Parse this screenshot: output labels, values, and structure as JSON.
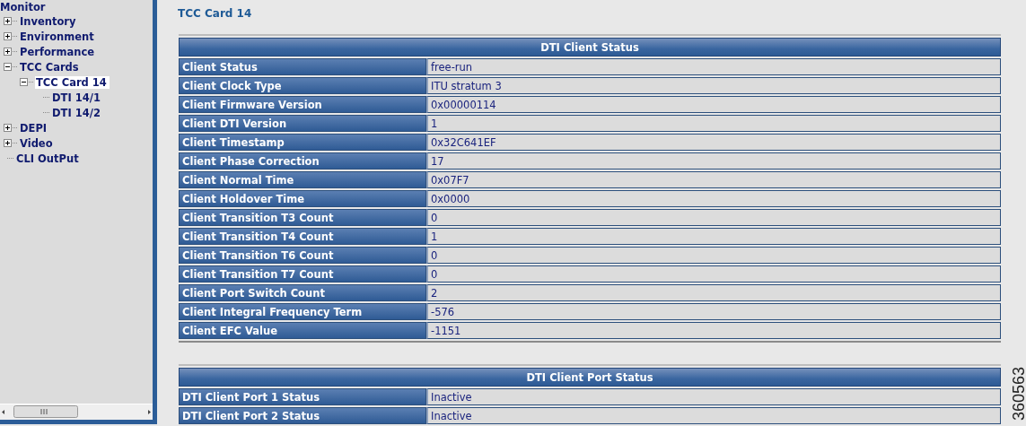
{
  "sidebar": {
    "tree": {
      "label": "Monitor",
      "children": [
        {
          "label": "Inventory",
          "expanded": false,
          "selected": false
        },
        {
          "label": "Environment",
          "expanded": false,
          "selected": false
        },
        {
          "label": "Performance",
          "expanded": false,
          "selected": false
        },
        {
          "label": "TCC Cards",
          "expanded": true,
          "selected": false,
          "children": [
            {
              "label": "TCC Card 14",
              "expanded": true,
              "selected": true,
              "children": [
                {
                  "label": "DTI 14/1",
                  "selected": false
                },
                {
                  "label": "DTI 14/2",
                  "selected": false
                }
              ]
            }
          ]
        },
        {
          "label": "DEPI",
          "expanded": false,
          "selected": false
        },
        {
          "label": "Video",
          "expanded": false,
          "selected": false
        },
        {
          "label": "CLI OutPut",
          "selected": false
        }
      ]
    }
  },
  "main": {
    "title": "TCC Card 14",
    "tables": [
      {
        "heading": "DTI Client Status",
        "rows": [
          [
            "Client Status",
            "free-run"
          ],
          [
            "Client Clock Type",
            "ITU stratum 3"
          ],
          [
            "Client Firmware Version",
            "0x00000114"
          ],
          [
            "Client DTI Version",
            "1"
          ],
          [
            "Client Timestamp",
            "0x32C641EF"
          ],
          [
            "Client Phase Correction",
            "17"
          ],
          [
            "Client Normal Time",
            "0x07F7"
          ],
          [
            "Client Holdover Time",
            "0x0000"
          ],
          [
            "Client Transition T3 Count",
            "0"
          ],
          [
            "Client Transition T4 Count",
            "1"
          ],
          [
            "Client Transition T6 Count",
            "0"
          ],
          [
            "Client Transition T7 Count",
            "0"
          ],
          [
            "Client Port Switch Count",
            "2"
          ],
          [
            "Client Integral Frequency Term",
            "-576"
          ],
          [
            "Client EFC Value",
            "-1151"
          ]
        ]
      },
      {
        "heading": "DTI Client Port Status",
        "rows": [
          [
            "DTI Client Port 1 Status",
            "Inactive"
          ],
          [
            "DTI Client Port 2 Status",
            "Inactive"
          ]
        ]
      }
    ]
  },
  "figure_id": "360563"
}
